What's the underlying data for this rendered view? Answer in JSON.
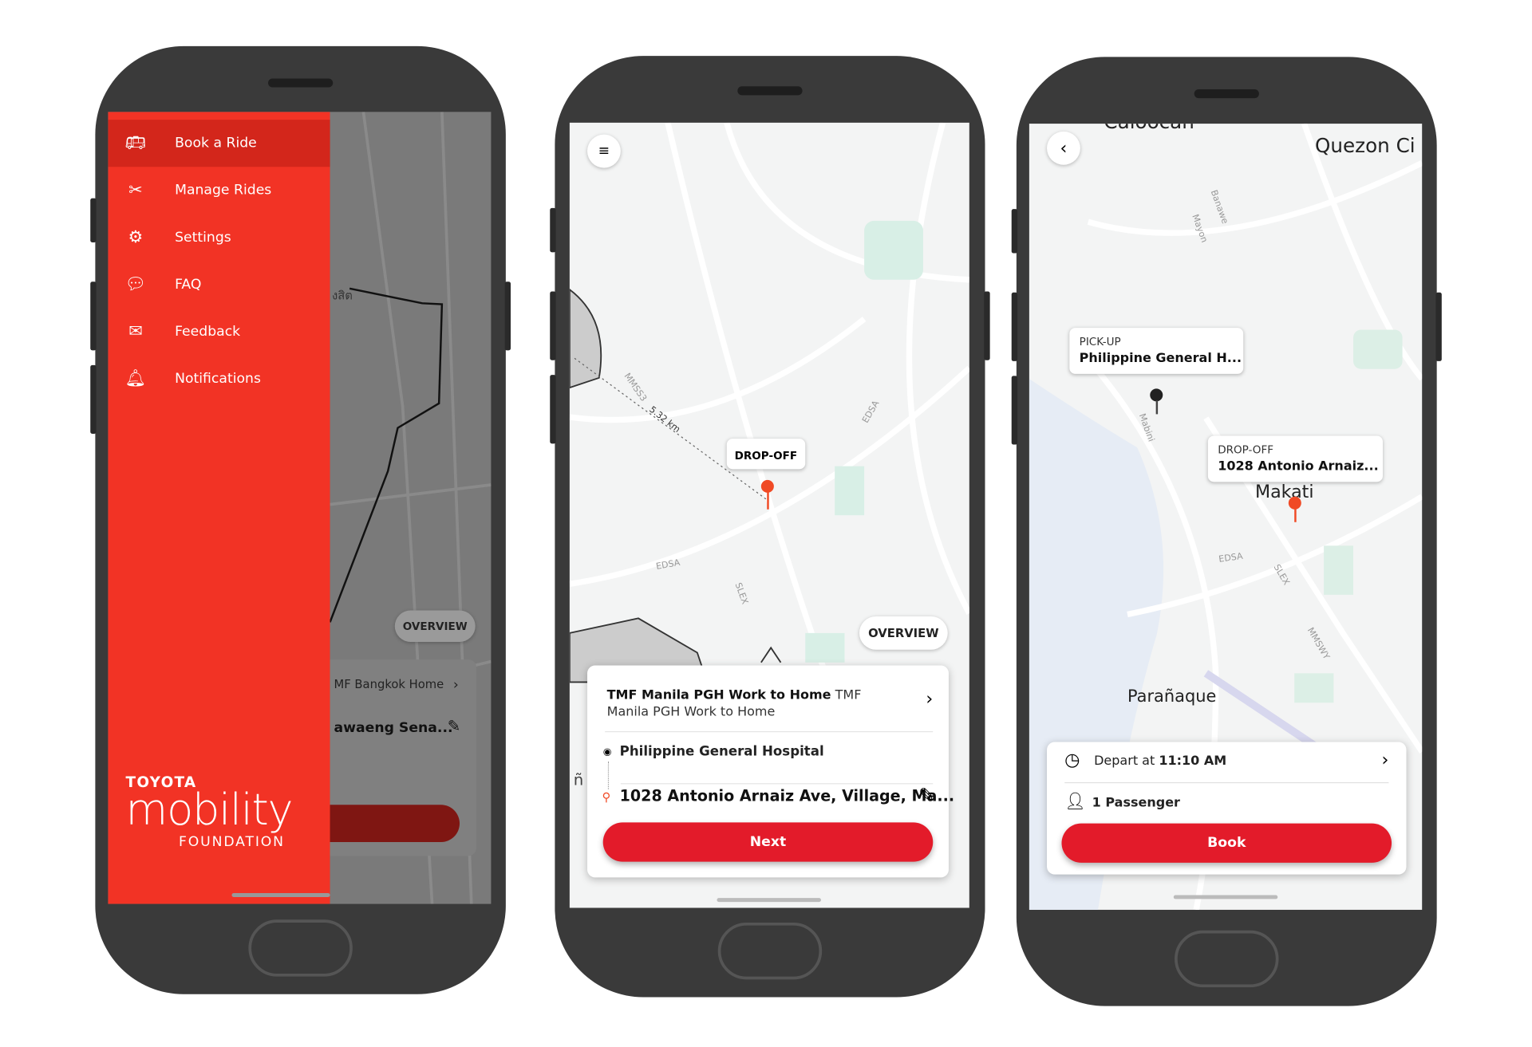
{
  "phone1": {
    "menu": [
      {
        "label": "Book a Ride",
        "icon": "bus-icon",
        "active": true
      },
      {
        "label": "Manage Rides",
        "icon": "tools-icon"
      },
      {
        "label": "Settings",
        "icon": "gear-icon"
      },
      {
        "label": "FAQ",
        "icon": "faq-bubble-icon"
      },
      {
        "label": "Feedback",
        "icon": "feedback-icon"
      },
      {
        "label": "Notifications",
        "icon": "bell-icon"
      }
    ],
    "logo": {
      "top": "TOYOTA",
      "main": "mobility",
      "bottom": "FOUNDATION"
    },
    "map_label": "งสิต",
    "overview": "OVERVIEW",
    "route_name": "MF Bangkok Home",
    "destination": "awaeng Sena..."
  },
  "phone2": {
    "drop_off_label": "DROP-OFF",
    "distance": "5.32 km",
    "map_labels": [
      "MMSS3",
      "EDSA",
      "EDSA",
      "SLEX"
    ],
    "overview": "OVERVIEW",
    "route_title_bold": "TMF Manila PGH Work to Home",
    "route_title_rest": "TMF Manila PGH Work to Home",
    "pickup": "Philippine General Hospital",
    "dropoff": "1028 Antonio Arnaiz Ave, Village, Ma...",
    "next": "Next"
  },
  "phone3": {
    "map_labels": {
      "north": "Caloocan",
      "city": "Quezon Ci",
      "makati": "Makati",
      "paranaque": "Parañaque",
      "edsa": "EDSA",
      "slex": "SLEX",
      "mabini": "Mabini",
      "mmswy": "MMSWY",
      "banawe": "Banawe",
      "mayon": "Mayon"
    },
    "pickup_key": "PICK-UP",
    "pickup_value": "Philippine General H...",
    "dropoff_key": "DROP-OFF",
    "dropoff_value": "1028 Antonio Arnaiz...",
    "depart_prefix": "Depart at ",
    "depart_time": "11:10 AM",
    "passengers": "1 Passenger",
    "book": "Book"
  },
  "colors": {
    "brand_red": "#f23325",
    "button_red": "#e31b2a",
    "phone_body": "#3a3a3a"
  }
}
